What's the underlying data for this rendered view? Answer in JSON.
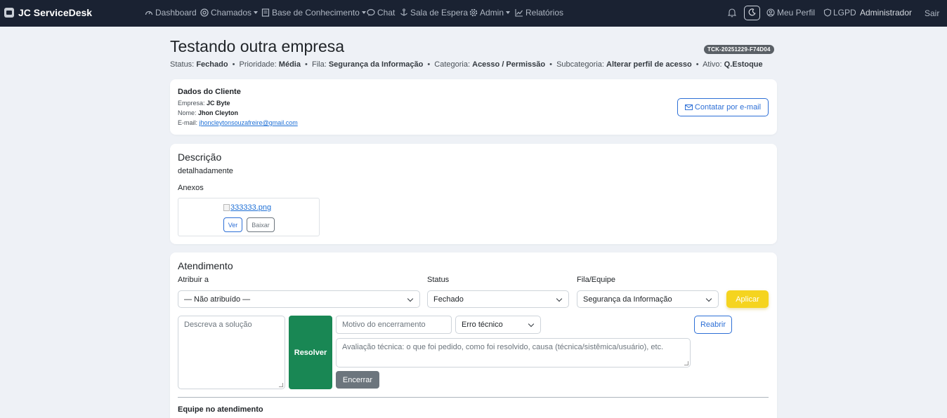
{
  "nav": {
    "brand": "JC ServiceDesk",
    "items": [
      {
        "label": "Dashboard",
        "icon": "dashboard-gauge-icon"
      },
      {
        "label": "Chamados",
        "icon": "lifebuoy-icon"
      },
      {
        "label": "Base de Conhecimento",
        "icon": "book-icon"
      },
      {
        "label": "Chat",
        "icon": "chat-bubble-icon"
      },
      {
        "label": "Sala de Espera",
        "icon": "anchor-icon"
      },
      {
        "label": "Admin",
        "icon": "gear-icon"
      },
      {
        "label": "Relatórios",
        "icon": "chart-line-icon"
      }
    ],
    "profile": "Meu Perfil",
    "lgpd": "LGPD",
    "user": "Administrador",
    "logout": "Sair"
  },
  "ticket": {
    "title": "Testando outra empresa",
    "code": "TCK-20251229-F74D04",
    "meta": {
      "status_label": "Status:",
      "status": "Fechado",
      "priority_label": "Prioridade:",
      "priority": "Média",
      "queue_label": "Fila:",
      "queue": "Segurança da Informação",
      "category_label": "Categoria:",
      "category": "Acesso / Permissão",
      "subcategory_label": "Subcategoria:",
      "subcategory": "Alterar perfil de acesso",
      "asset_label": "Ativo:",
      "asset": "Q.Estoque"
    }
  },
  "client": {
    "title": "Dados do Cliente",
    "company_label": "Empresa:",
    "company": "JC Byte",
    "name_label": "Nome:",
    "name": "Jhon Cleyton",
    "email_label": "E-mail:",
    "email": "jhoncleytonsouzafreire@gmail.com",
    "contact_button": "Contatar por e-mail"
  },
  "description": {
    "title": "Descrição",
    "text": "detalhadamente",
    "attachments_title": "Anexos",
    "attachment_name": "333333.png",
    "view_button": "Ver",
    "download_button": "Baixar"
  },
  "service": {
    "title": "Atendimento",
    "assign_label": "Atribuir a",
    "assign_value": "— Não atribuído —",
    "status_label": "Status",
    "status_value": "Fechado",
    "queue_label": "Fila/Equipe",
    "queue_value": "Segurança da Informação",
    "apply_button": "Aplicar",
    "solution_placeholder": "Descreva a solução",
    "resolve_button": "Resolver",
    "close_reason_placeholder": "Motivo do encerramento",
    "error_type_value": "Erro técnico",
    "reopen_button": "Reabrir",
    "evaluation_placeholder": "Avaliação técnica: o que foi pedido, como foi resolvido, causa (técnica/sistêmica/usuário), etc.",
    "close_button": "Encerrar",
    "team_title": "Equipe no atendimento"
  },
  "colors": {
    "navbar": "#1a2232",
    "primary": "#2d6fd6",
    "success": "#198754",
    "warning": "#f5d41f",
    "secondary": "#6c757d"
  }
}
